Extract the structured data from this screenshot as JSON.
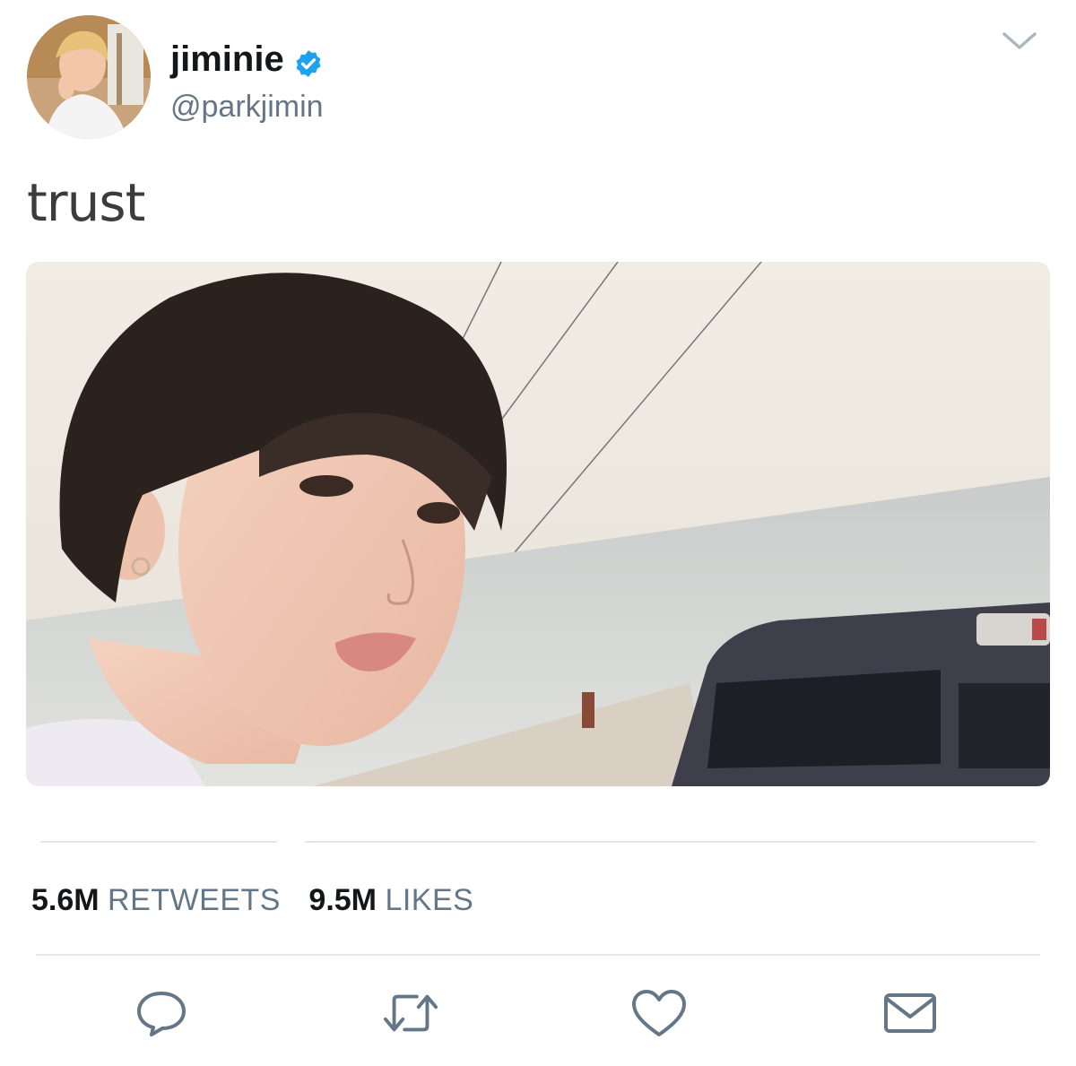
{
  "user": {
    "display_name": "jiminie",
    "handle": "@parkjimin",
    "verified": true,
    "avatar_alt": "profile photo"
  },
  "tweet": {
    "text": "trust",
    "media": "photo"
  },
  "stats": {
    "retweets_count": "5.6M",
    "retweets_label": "RETWEETS",
    "likes_count": "9.5M",
    "likes_label": "LIKES"
  },
  "actions": [
    "reply-icon",
    "retweet-icon",
    "heart-icon",
    "mail-icon"
  ],
  "colors": {
    "verified": "#1da1f2",
    "text_primary": "#14171a",
    "text_secondary": "#657786",
    "divider": "#e1e8ed",
    "icon": "#657786"
  }
}
